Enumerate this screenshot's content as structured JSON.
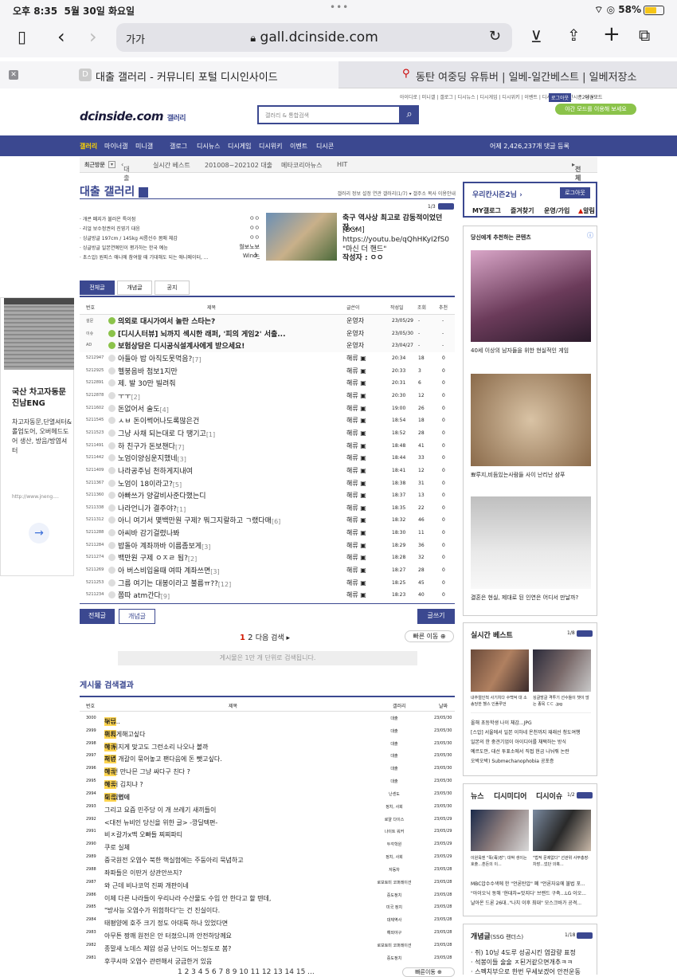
{
  "statusbar": {
    "time": "오후 8:35",
    "date": "5월 30일 화요일",
    "battery": "58%",
    "dots": "•••"
  },
  "browser": {
    "text_size": "가가",
    "url": "gall.dcinside.com",
    "tab1_favicon": "D",
    "tab1_title": "대출 갤러리 - 커뮤니티 포털 디시인사이드",
    "tab2_title": "동탄 여중딩 유튜버 | 일베-일간베스트 | 일베저장소"
  },
  "header": {
    "topnav": "아이디로 | 미니갤 | 갤로그 | 디시뉴스 | 디시게임 | 디시위키 | 이벤트 | 디시콘 | 우리칸시즌2님 ▾",
    "login": "로그아웃",
    "darkmode": "야간모드",
    "logo": "dcinside.com",
    "logo_sub": "갤러리",
    "search_placeholder": "갤러리 & 통합검색",
    "night_pill": "야간 모드를 이용해 보세요"
  },
  "mainnav": {
    "items": [
      "갤러리",
      "마이너갤",
      "미니갤",
      "갤로그",
      "디시뉴스",
      "디시게임",
      "디시위키",
      "이벤트",
      "디시콘"
    ],
    "stats": "어제 2,426,237개 댓글 등록"
  },
  "subnav": {
    "recent": "최근방문",
    "items": [
      "대출",
      "실시간 베스트",
      "201008~202102 대출",
      "메타코리아뉴스",
      "HIT"
    ],
    "all": "전체"
  },
  "gallery": {
    "title": "대출 갤러리",
    "info": "갤러리 정보  설정  연관 갤러리(1/7) ▾  갤주소 복사  이용안내",
    "page_ind": "1/3"
  },
  "announcements": [
    {
      "text": "· 개콘 폐지가 불러온 특이점",
      "mark": "ㅇㅇ"
    },
    {
      "text": "· 리얼 보수정권의 진영기 대응",
      "mark": "ㅇㅇ"
    },
    {
      "text": "· 싱글방글 197cm / 145kg 씨름선수 몸매 체감",
      "mark": "ㅇㅇ"
    },
    {
      "text": "· 싱글방글 일본연예인이 평가하는 한국 예능",
      "mark": "월보노보노"
    },
    {
      "text": "· 초스압) 원피스 애니에 참여할 때 기대해도 되는 애니메이터, ...",
      "mark": "Wind_"
    }
  ],
  "featured": {
    "title": "축구 역사상 최고로 감동적이었던 장...",
    "body": "[BGM]\nhttps://youtu.be/qQhHKyI2fS0 \"마신 더 핸드\"",
    "author_label": "작성자 :",
    "author": "ㅇㅇ"
  },
  "tabs": [
    "전체글",
    "개념글",
    "공지"
  ],
  "columns": {
    "num": "번호",
    "title": "제목",
    "author": "글쓴이",
    "date": "작성일",
    "views": "조회",
    "rec": "추천"
  },
  "notices": [
    {
      "num": "설문",
      "title": "의외로 대시가여서 놀란 스타는?",
      "author": "운영자",
      "date": "23/05/29",
      "views": "-",
      "rec": "-"
    },
    {
      "num": "이슈",
      "title": "[디시人터뷰] 뇌까지 섹시한 래퍼, '피의 게임2' 서출...",
      "author": "운영자",
      "date": "23/05/30",
      "views": "-",
      "rec": "-"
    },
    {
      "num": "AD",
      "title": "보험상담은 디시공식설계사에게 받으세요!",
      "author": "운영자",
      "date": "23/04/27",
      "views": "-",
      "rec": "-"
    }
  ],
  "posts": [
    {
      "num": "5212947",
      "title": "아들아 밥 아직도못먹음?",
      "c": "[7]",
      "author": "해류",
      "date": "20:34",
      "views": "18",
      "rec": "0"
    },
    {
      "num": "5212925",
      "title": "헬붕음바 첨보1지만",
      "c": "",
      "author": "해류",
      "date": "20:33",
      "views": "3",
      "rec": "0"
    },
    {
      "num": "5212891",
      "title": "제. 발 30만 빌려줘",
      "c": "",
      "author": "해류",
      "date": "20:31",
      "views": "6",
      "rec": "0"
    },
    {
      "num": "5212878",
      "title": "ㅜㅜ",
      "c": "[2]",
      "author": "해류",
      "date": "20:30",
      "views": "12",
      "rec": "0"
    },
    {
      "num": "5211602",
      "title": "돈없어서 술도",
      "c": "[4]",
      "author": "해류",
      "date": "19:00",
      "views": "26",
      "rec": "0"
    },
    {
      "num": "5211545",
      "title": "ㅅㅂ 돈이썩어나도록많은건",
      "c": "",
      "author": "해류",
      "date": "18:54",
      "views": "18",
      "rec": "0"
    },
    {
      "num": "5211523",
      "title": "그냥 사채 되는대로 다 땡기고",
      "c": "[1]",
      "author": "해류",
      "date": "18:52",
      "views": "28",
      "rec": "0"
    },
    {
      "num": "5211491",
      "title": "하 친구가 돈보챈다",
      "c": "[7]",
      "author": "해류",
      "date": "18:48",
      "views": "41",
      "rec": "0"
    },
    {
      "num": "5211442",
      "title": "노엄이양심운지했네",
      "c": "[3]",
      "author": "해류",
      "date": "18:44",
      "views": "33",
      "rec": "0"
    },
    {
      "num": "5211409",
      "title": "나라공주님 천하게지내여",
      "c": "",
      "author": "해류",
      "date": "18:41",
      "views": "12",
      "rec": "0"
    },
    {
      "num": "5211367",
      "title": "노엄이 18이라고?",
      "c": "[5]",
      "author": "해류",
      "date": "18:38",
      "views": "31",
      "rec": "0"
    },
    {
      "num": "5211360",
      "title": "아빠쓰가 양갈비사준다했는디",
      "c": "",
      "author": "해류",
      "date": "18:37",
      "views": "13",
      "rec": "0"
    },
    {
      "num": "5211338",
      "title": "나라언니가 결주야?",
      "c": "[1]",
      "author": "해류",
      "date": "18:35",
      "views": "22",
      "rec": "0"
    },
    {
      "num": "5211312",
      "title": "아니 여기서 몇백만원 구제? 뭐그지랄하고 ㄱ랬다매",
      "c": "[6]",
      "author": "해류",
      "date": "18:32",
      "views": "46",
      "rec": "0"
    },
    {
      "num": "5211288",
      "title": "아씨바 감기걸렸나봐",
      "c": "",
      "author": "해류",
      "date": "18:30",
      "views": "11",
      "rec": "0"
    },
    {
      "num": "5211284",
      "title": "밥돌아 계좌까바 이름좀보게",
      "c": "[3]",
      "author": "해류",
      "date": "18:29",
      "views": "36",
      "rec": "0"
    },
    {
      "num": "5211274",
      "title": "백만원 구제 ㅇㅈㄹ 됨?",
      "c": "[2]",
      "author": "해류",
      "date": "18:28",
      "views": "32",
      "rec": "0"
    },
    {
      "num": "5211269",
      "title": "아 버스비입을때 여따 계좌쓰면",
      "c": "[3]",
      "author": "해류",
      "date": "18:27",
      "views": "28",
      "rec": "0"
    },
    {
      "num": "5211253",
      "title": "그름 여기는 대봉이라고 불름ㅠ??",
      "c": "[12]",
      "author": "해류",
      "date": "18:25",
      "views": "45",
      "rec": "0"
    },
    {
      "num": "5211234",
      "title": "쫌따 atm간다",
      "c": "[9]",
      "author": "해류",
      "date": "18:23",
      "views": "40",
      "rec": "0"
    }
  ],
  "bottom": {
    "all": "전체글",
    "concept": "개념글",
    "write": "글쓰기",
    "pages": [
      "1",
      "2"
    ],
    "next": "다음 검색 ▸",
    "quick": "빠른 이동 ⊕",
    "notice": "게시물은 1만 개 단위로 검색됩니다."
  },
  "search_results": {
    "title": "게시물 검색결과",
    "columns": {
      "num": "번호",
      "title": "제목",
      "gallery": "갤러리",
      "date": "날짜"
    },
    "rows": [
      {
        "num": "3000",
        "pre": "",
        "hl": "해류",
        "post": "누님..",
        "gallery": "대출",
        "date": "23/05/30"
      },
      {
        "num": "2999",
        "pre": "",
        "hl": "해류",
        "post": " 위지게해고싶다",
        "gallery": "대출",
        "date": "23/05/30"
      },
      {
        "num": "2998",
        "pre": "",
        "hl": "해류",
        "post": "야 뒤지게 맞고도 그런소리 나오나 볼까",
        "gallery": "대출",
        "date": "23/05/30"
      },
      {
        "num": "2997",
        "pre": "",
        "hl": "해류",
        "post": " 저년 개갈이 묶어놓고 팬다음에 돈 뺏고싶다.",
        "gallery": "대출",
        "date": "23/05/30"
      },
      {
        "num": "2996",
        "pre": "",
        "hl": "해류",
        "post": "야 넌 만나믄 그냥 싸다구 친다 ?",
        "gallery": "대출",
        "date": "23/05/30"
      },
      {
        "num": "2995",
        "pre": "",
        "hl": "해류",
        "post": "야 너 김치냐 ?",
        "gallery": "대출",
        "date": "23/05/30"
      },
      {
        "num": "2994",
        "pre": "와 해변에 ",
        "hl": "해류",
        "post": "도 있었네",
        "gallery": "난센도",
        "date": "23/05/30"
      },
      {
        "num": "2993",
        "pre": "그리고 요즘 민주당 이 개 쓰레기 새끼들이",
        "hl": "",
        "post": "",
        "gallery": "정치, 사회",
        "date": "23/05/30"
      },
      {
        "num": "2992",
        "pre": "<대전 뉴비인 당신을 위한 글> -깡딜텍편-",
        "hl": "",
        "post": "",
        "gallery": "로얄 다이스",
        "date": "23/05/29"
      },
      {
        "num": "2991",
        "pre": "비ㅈ갈가x맥 오빠들 찌찌파티",
        "hl": "",
        "post": "",
        "gallery": "나이트 워커",
        "date": "23/05/29"
      },
      {
        "num": "2990",
        "pre": "쿠로 실체",
        "hl": "",
        "post": "",
        "gallery": "두각학원",
        "date": "23/05/29"
      },
      {
        "num": "2989",
        "pre": "중국원전 오염수 북한 핵실험에는 주둥아리 묵념하고",
        "hl": "",
        "post": "",
        "gallery": "정치, 사회",
        "date": "23/05/29"
      },
      {
        "num": "2988",
        "pre": "좌파들은 이딴거 상관안쓰지?",
        "hl": "",
        "post": "",
        "gallery": "자동차",
        "date": "23/05/28"
      },
      {
        "num": "2987",
        "pre": "와 근데 비나코억 진짜 개판이네",
        "hl": "",
        "post": "",
        "gallery": "로보토미 코퍼레이션",
        "date": "23/05/28"
      },
      {
        "num": "2986",
        "pre": "이제 다른 나라들이 우리나라 수산물도 수입 안 한다고 할 텐데,",
        "hl": "",
        "post": "",
        "gallery": "중도정치",
        "date": "23/05/28"
      },
      {
        "num": "2985",
        "pre": "\"방사능 오염수가 위험하다\"는 건 진실이다.",
        "hl": "",
        "post": "",
        "gallery": "미국 정치",
        "date": "23/05/28"
      },
      {
        "num": "2984",
        "pre": "태평양에 호주 크기 정도 아대륙 하나 있었다면",
        "hl": "",
        "post": "",
        "gallery": "대체역사",
        "date": "23/05/28"
      },
      {
        "num": "2983",
        "pre": "아무튼 짱깨 원전은 안 터졌으니까 안전하당께요",
        "hl": "",
        "post": "",
        "gallery": "해외야구",
        "date": "23/05/28"
      },
      {
        "num": "2982",
        "pre": "종말새 노데스 제압 성공 난이도 어느정도로 봄?",
        "hl": "",
        "post": "",
        "gallery": "로보토미 코퍼레이션",
        "date": "23/05/28"
      },
      {
        "num": "2981",
        "pre": "후쿠시마 오염수 관련해서 궁금한거 있음",
        "hl": "",
        "post": "",
        "gallery": "중도정치",
        "date": "23/05/28"
      }
    ],
    "pager": "1 2 3 4 5 6 7 8 9 10 11 12 13 14 15 ...",
    "quick": "빠른이동 ⊕"
  },
  "left_ad": {
    "title": "국산 차고자동문 진남ENG",
    "body": "차고자동문,단열셔터&롤업도어, 오버헤드도어 생산, 방음/방염셔터",
    "url": "http://www.jneng...."
  },
  "sidebar": {
    "user": "우리칸시즌2님",
    "logout": "로그아웃",
    "links": [
      "MY갤로그",
      "즐겨찾기",
      "운영/가입",
      "알림"
    ],
    "rec_title": "당신에게 추천하는 콘텐츠",
    "rec": [
      "40세 이상의 남자들을 위한 현실적인 게임",
      "뾰루지,비듬있는사람들 사이 난리난 샴푸",
      "결혼은 현실, 제대로 된 인연은 어디서 만날까?"
    ],
    "best_title": "실시간 베스트",
    "best_page": "1/8",
    "best": [
      "내추럴인척 사기치다 수백억 대 소송당한 헬스 인플루언",
      "싱글방글 격투기 선수들이 챗이 많는 종목 ㄷㄷ .jpg"
    ],
    "best_list": [
      "올해 초등학생 나이 체감...JPG",
      "[스압] 서울에서 일본 이하네 온천까지 재래선 청도여행",
      "일본의 한 중견기업이 아이디어를 채택하는 방식",
      "예르도안, 대선 투표소에서 직접 현금 나눠줘 논란",
      "오박오박) Submechanophobia 공포증"
    ],
    "news_tabs": [
      "뉴스",
      "디시미디어",
      "디시이슈"
    ],
    "news_page": "1/2",
    "news": [
      "이원욱엔 \"똑(毒)장\"; 대박 생이는 호출...훈돈의 이...",
      "\"법적 문제없다\" 선관위 사무총장·차장...었단 의혹..."
    ],
    "news_list": [
      "MBC압수수색에 한 \"언론탄압\" 폐 \"언론자유에 불법 포...",
      "\"아이오닉 동해 '현대차=맛지다' 브랜드 구축...LG 이오...",
      "날아온 드론 26대..\"나치 이후 최대\" 모스크바가 공격..."
    ],
    "concept_title": "개념글",
    "concept_sub": "(SSG 랜더스)",
    "concept_page": "1/18",
    "concept": [
      "· 쥐) 10닝 4도루 성공시킨 염갈량 표정",
      "· 석봉이들 술술 ㅈ된거같으면개추ㅋㅋ",
      "· 스펙치부으로 한번 무세보겠어 안전운동"
    ]
  },
  "icons": [
    "sidebar-icon",
    "back-icon",
    "forward-icon",
    "lock-icon",
    "reload-icon",
    "download-icon",
    "share-icon",
    "plus-icon",
    "tabs-icon",
    "search-icon",
    "arrow-right-icon",
    "info-icon"
  ]
}
